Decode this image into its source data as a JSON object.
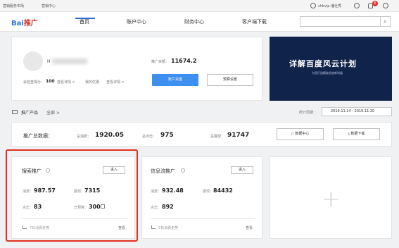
{
  "topbar": {
    "links": [
      "营销服务市场",
      "营销中心"
    ],
    "username": "shbvip-潘仕秀",
    "notif_count": "6"
  },
  "brand": {
    "logo_part1": "Bai",
    "logo_part2": "推广"
  },
  "nav": {
    "items": [
      "首页",
      "账户中心",
      "财务中心",
      "客户端下载"
    ]
  },
  "account": {
    "user_initial": "H",
    "balance_label": "推广余额：",
    "balance_value": "11674.2",
    "level_label": "会检查得分：",
    "level_value": "100",
    "view_details": "查看详情 >",
    "my_benefits": "我的优惠",
    "recharge_button": "账户充值",
    "budget_button": "预算设置"
  },
  "banner": {
    "title": "详解百度风云计划",
    "subtitle": "为您打造精准投放新利器"
  },
  "products": {
    "title": "推广产品",
    "filter": "全部 >",
    "date_label": "统计周期：",
    "date_range": "2019.11.14 - 2019.11.20",
    "total_label": "推广总数据：",
    "consume_label": "总消费：",
    "consume_value": "1920.05",
    "click_label": "总点击：",
    "click_value": "975",
    "show_label": "总展现：",
    "show_value": "91747",
    "data_center": "数据中心",
    "data_download": "数据下载"
  },
  "search_promo": {
    "title": "搜索推广",
    "enter": "进入",
    "consume_label": "消费：",
    "consume_value": "987.57",
    "show_label": "展现：",
    "show_value": "7315",
    "click_label": "点击：",
    "click_value": "83",
    "budget_label": "日预算：",
    "budget_value": "300",
    "trend": "7日消费走势",
    "view": "查看"
  },
  "feed_promo": {
    "title": "信息流推广",
    "enter": "进入",
    "consume_label": "消费：",
    "consume_value": "932.48",
    "show_label": "展现：",
    "show_value": "84432",
    "click_label": "点击：",
    "click_value": "892",
    "trend": "7日消费走势",
    "view": "查看"
  },
  "add_card": {
    "symbol": "+"
  }
}
